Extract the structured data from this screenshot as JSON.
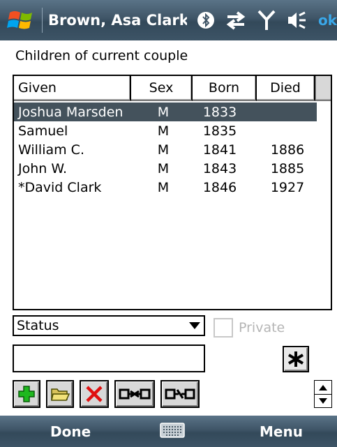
{
  "titlebar": {
    "title": "Brown, Asa Clark &",
    "ok_label": "ok"
  },
  "heading": "Children of current couple",
  "columns": [
    "Given",
    "Sex",
    "Born",
    "Died"
  ],
  "children": [
    {
      "given": "Joshua Marsden",
      "sex": "M",
      "born": "1833",
      "died": ""
    },
    {
      "given": "Samuel",
      "sex": "M",
      "born": "1835",
      "died": ""
    },
    {
      "given": "William C.",
      "sex": "M",
      "born": "1841",
      "died": "1886"
    },
    {
      "given": "John W.",
      "sex": "M",
      "born": "1843",
      "died": "1885"
    },
    {
      "given": "*David Clark",
      "sex": "M",
      "born": "1846",
      "died": "1927"
    }
  ],
  "status_combo": {
    "value": "Status"
  },
  "private_checkbox": {
    "label": "Private",
    "checked": false
  },
  "text_input": {
    "value": ""
  },
  "softkeys": {
    "left": "Done",
    "right": "Menu"
  },
  "colors": {
    "selected_row": "#44525c",
    "title_bar": "#3f5567",
    "ok_color": "#3aa7e8"
  }
}
